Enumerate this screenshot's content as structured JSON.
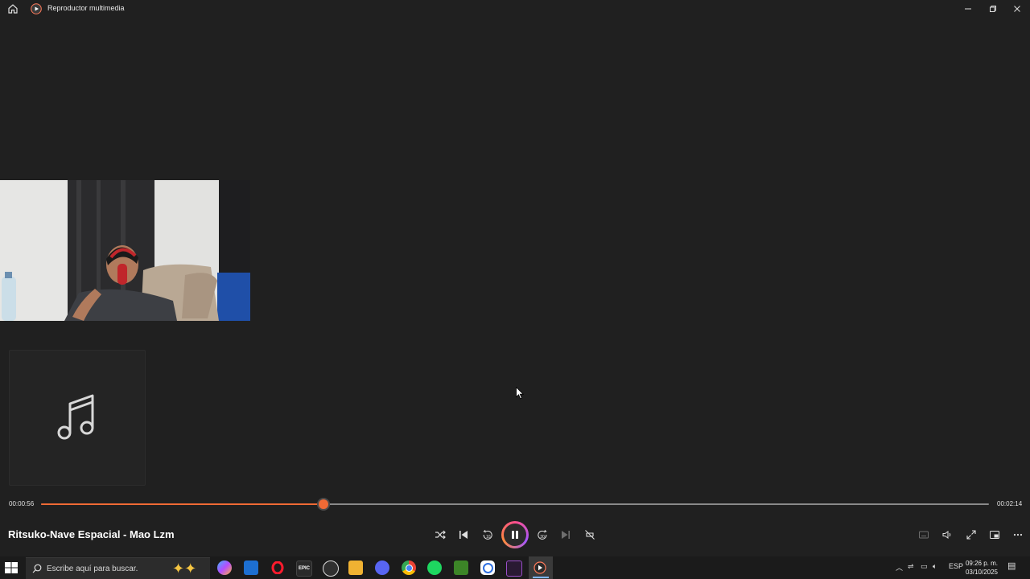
{
  "window": {
    "title": "Reproductor multimedia"
  },
  "player": {
    "elapsed": "00:00:56",
    "total": "00:02:14",
    "progress_fraction": 0.298,
    "song_title": "Ritsuko-Nave Espacial - Mao Lzm",
    "accent_color": "#ef6a35",
    "state": "playing"
  },
  "controls": {
    "shuffle_icon": "shuffle-icon",
    "previous_icon": "previous-track-icon",
    "rewind_label": "10",
    "play_pause_icon": "pause-icon",
    "forward_label": "30",
    "next_icon": "next-track-icon",
    "repeat_icon": "repeat-off-icon"
  },
  "taskbar": {
    "search_placeholder": "Escribe aquí para buscar.",
    "apps": [
      "copilot",
      "mail",
      "opera",
      "epic-games",
      "obs",
      "file-explorer",
      "discord",
      "chrome",
      "spotify",
      "minecraft",
      "app",
      "vs",
      "media-player"
    ],
    "epic_label": "EPIC",
    "language": "ESP",
    "time": "09:26 p. m.",
    "date": "03/10/2025"
  }
}
